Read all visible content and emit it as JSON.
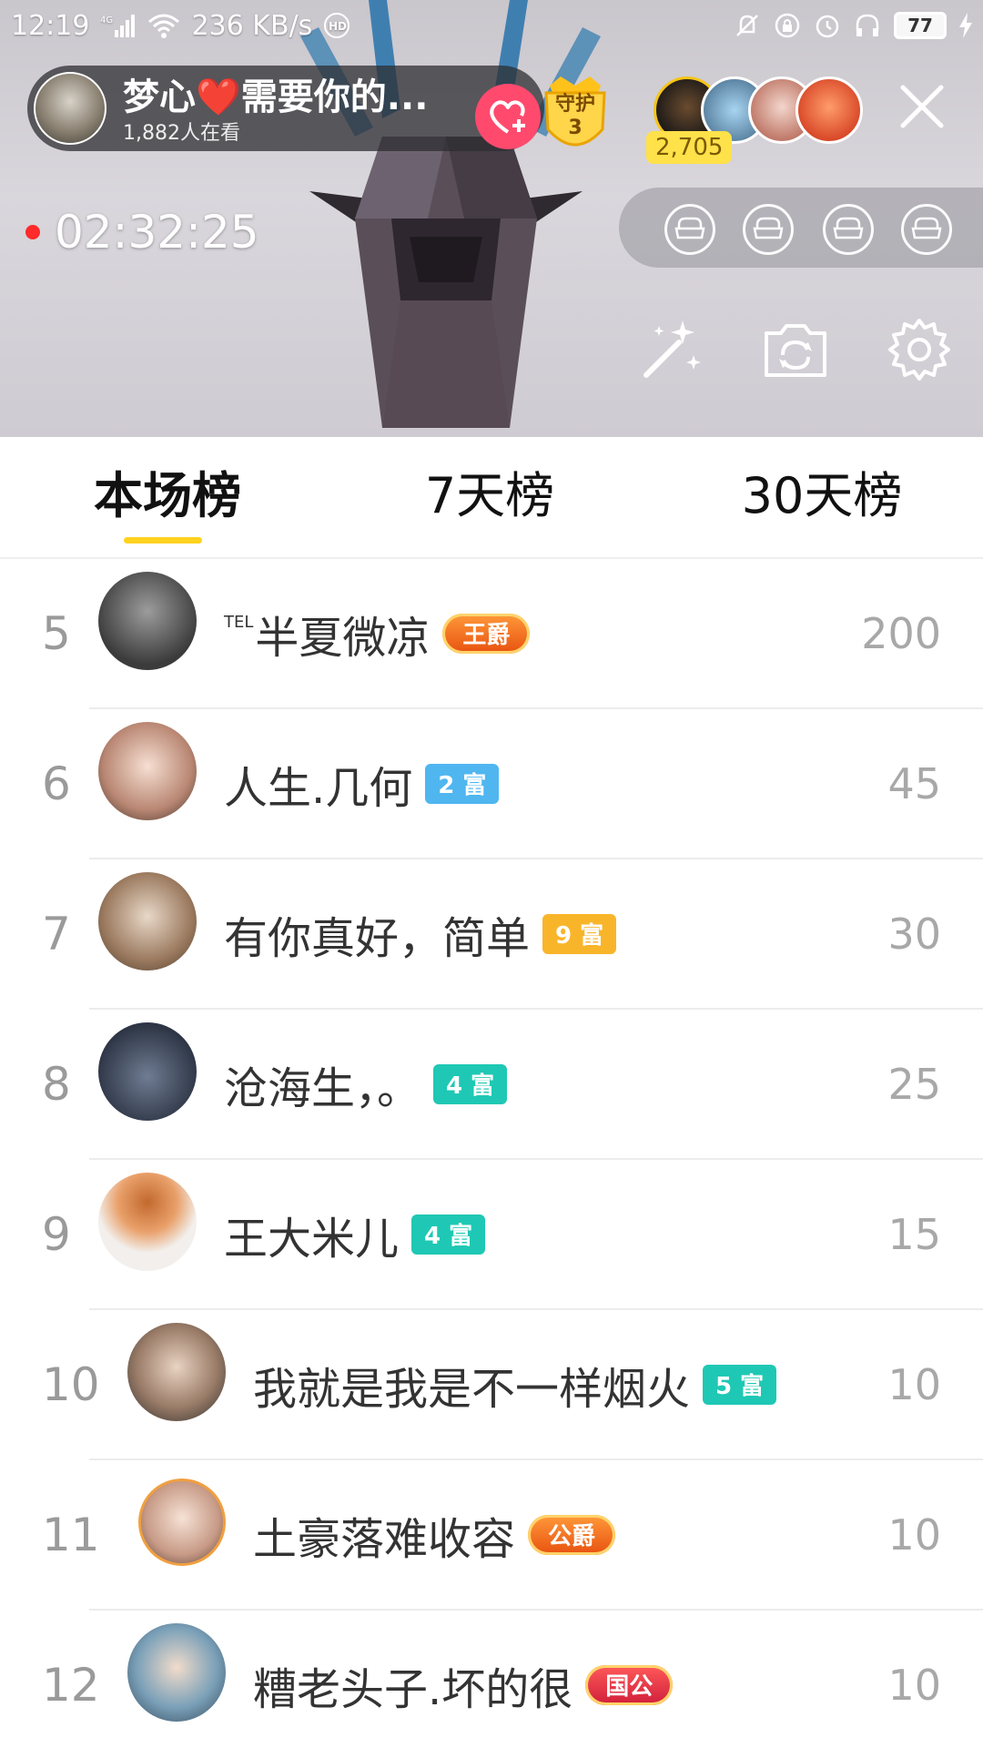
{
  "status_bar": {
    "time": "12:19",
    "network": "4G",
    "speed": "236 KB/s",
    "hd": "HD",
    "battery": "77"
  },
  "anchor": {
    "name": "梦心❤️需要你的...",
    "viewers": "1,882人在看"
  },
  "guard": {
    "label": "守护",
    "count": "3"
  },
  "viewer_count": "2,705",
  "live_timer": "02:32:25",
  "tabs": [
    {
      "label": "本场榜",
      "active": true
    },
    {
      "label": "7天榜",
      "active": false
    },
    {
      "label": "30天榜",
      "active": false
    }
  ],
  "ranking": [
    {
      "rank": "5",
      "prefix": "TEL",
      "name": "半夏微凉",
      "badge": "王爵",
      "badge_color": "#f08a1e",
      "score": "200"
    },
    {
      "rank": "6",
      "prefix": "",
      "name": "人生.几何",
      "badge": "2 富",
      "badge_color": "#4fb6f0",
      "score": "45"
    },
    {
      "rank": "7",
      "prefix": "",
      "name": "有你真好，简单",
      "badge": "9 富",
      "badge_color": "#f9b52a",
      "score": "30"
    },
    {
      "rank": "8",
      "prefix": "",
      "name": "沧海生，。",
      "badge": "4 富",
      "badge_color": "#1fc8b4",
      "score": "25"
    },
    {
      "rank": "9",
      "prefix": "",
      "name": "王大米儿",
      "badge": "4 富",
      "badge_color": "#1fc8b4",
      "score": "15"
    },
    {
      "rank": "10",
      "prefix": "",
      "name": "我就是我是不一样烟火",
      "badge": "5 富",
      "badge_color": "#1fc8b4",
      "score": "10"
    },
    {
      "rank": "11",
      "prefix": "",
      "name": "土豪落难收容",
      "badge": "公爵",
      "badge_color": "#ff6a2a",
      "score": "10"
    },
    {
      "rank": "12",
      "prefix": "",
      "name": "糟老头子.坏的很",
      "badge": "国公",
      "badge_color": "#e8283c",
      "score": "10"
    }
  ],
  "icons": {
    "follow": "heart-plus-icon",
    "close": "close-icon",
    "seats": "sofa-icon",
    "beauty": "magic-wand-icon",
    "flip_camera": "camera-switch-icon",
    "settings": "gear-icon"
  }
}
